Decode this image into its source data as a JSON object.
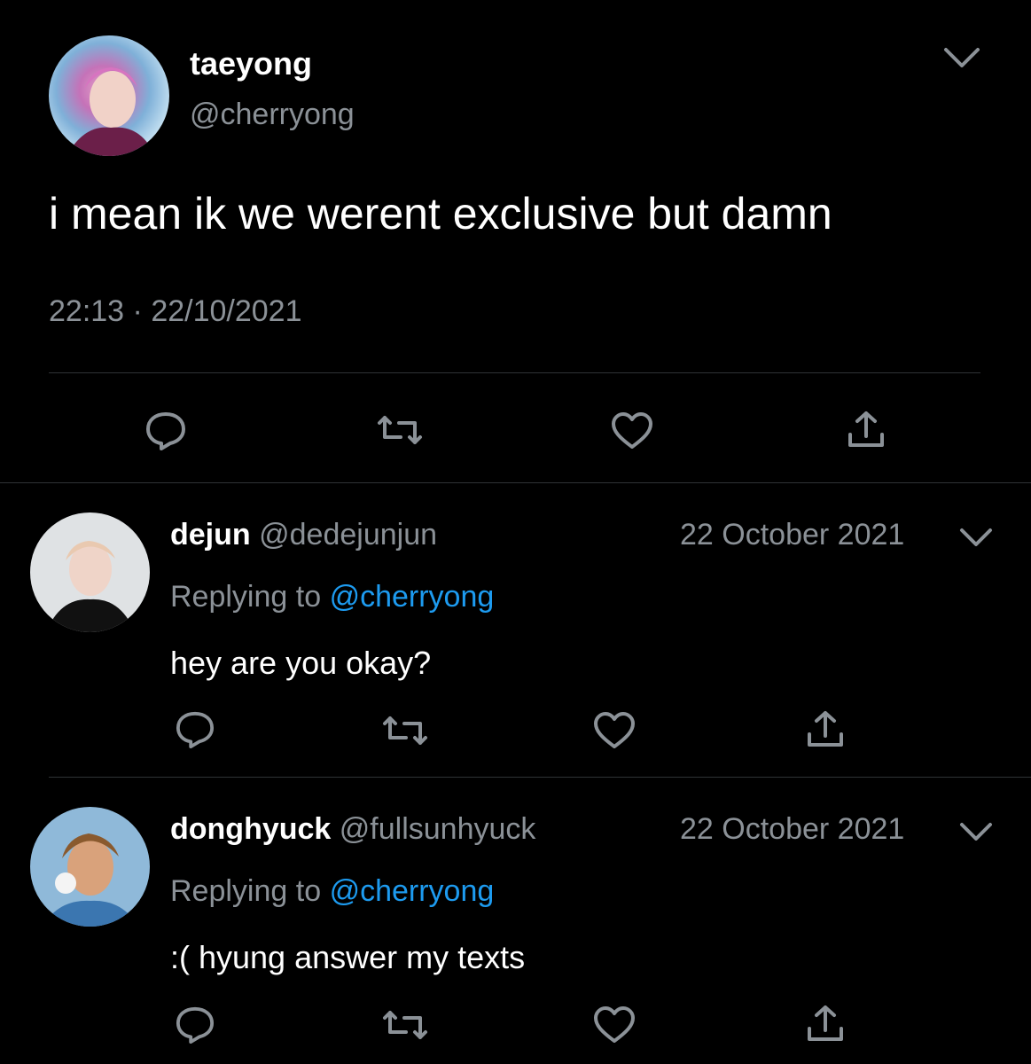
{
  "main_tweet": {
    "display_name": "taeyong",
    "handle": "@cherryong",
    "text": "i mean ik we werent exclusive but damn",
    "time": "22:13",
    "separator": "·",
    "date": "22/10/2021"
  },
  "replies": [
    {
      "display_name": "dejun",
      "handle": "@dedejunjun",
      "date": "22 October 2021",
      "replying_prefix": "Replying to",
      "replying_handle": "@cherryong",
      "text": "hey are you okay?"
    },
    {
      "display_name": "donghyuck",
      "handle": "@fullsunhyuck",
      "date": "22 October 2021",
      "replying_prefix": "Replying to",
      "replying_handle": "@cherryong",
      "text": ":( hyung answer my texts"
    }
  ],
  "icons": [
    "chevron-down-icon",
    "reply-icon",
    "retweet-icon",
    "like-icon",
    "share-icon"
  ],
  "colors": {
    "background": "#000000",
    "text": "#ffffff",
    "muted": "#8b9197",
    "link": "#1d9bf0",
    "divider": "#2f3336"
  }
}
